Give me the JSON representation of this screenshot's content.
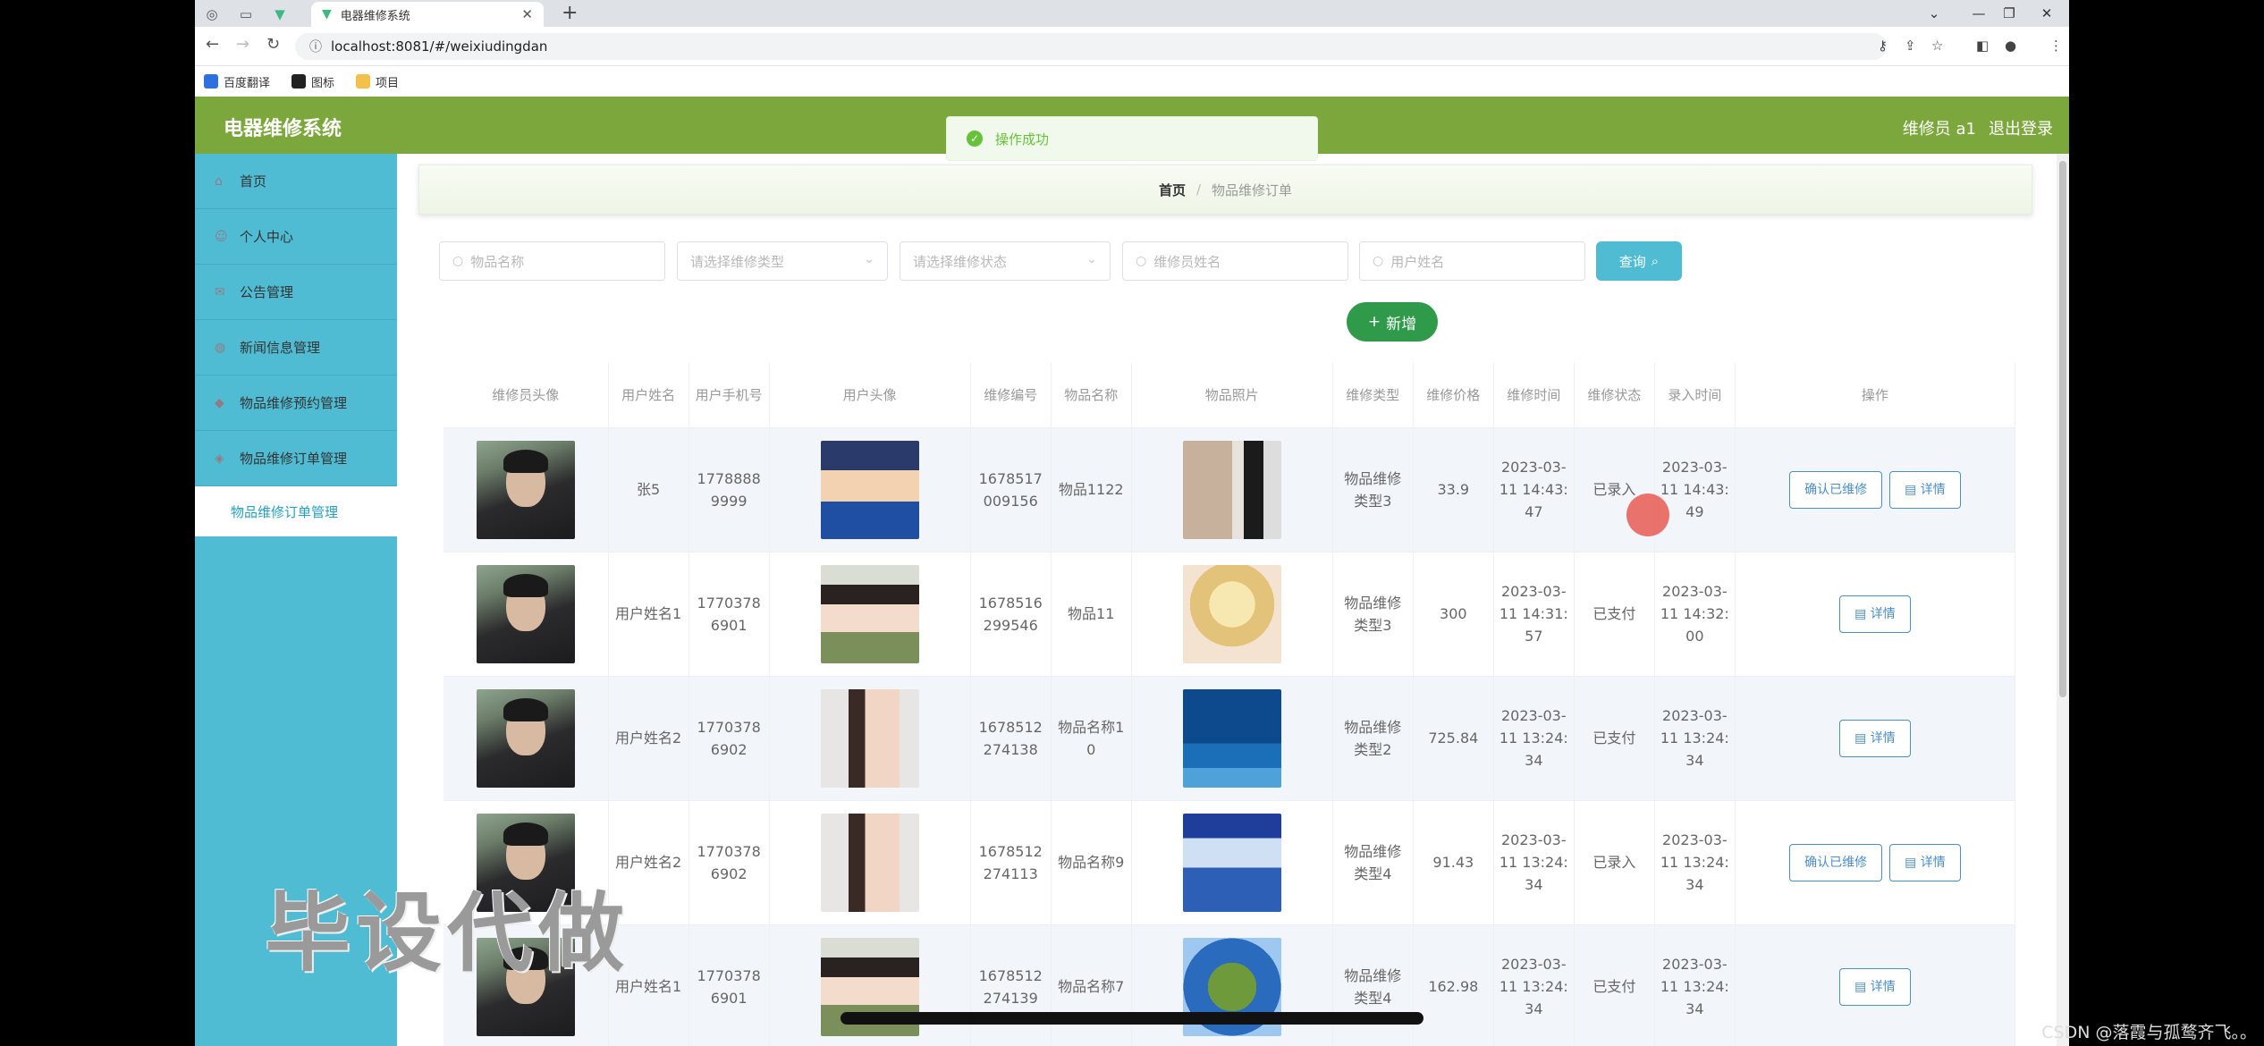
{
  "browser": {
    "tab_title": "电器维修系统",
    "url": "localhost:8081/#/weixiudingdan",
    "bookmarks": [
      "百度翻译",
      "图标",
      "项目"
    ]
  },
  "app": {
    "title": "电器维修系统",
    "user": "维修员 a1",
    "logout": "退出登录",
    "toast": "操作成功"
  },
  "sidebar": {
    "items": [
      {
        "label": "首页"
      },
      {
        "label": "个人中心"
      },
      {
        "label": "公告管理"
      },
      {
        "label": "新闻信息管理"
      },
      {
        "label": "物品维修预约管理"
      },
      {
        "label": "物品维修订单管理"
      }
    ],
    "active_sub": "物品维修订单管理"
  },
  "breadcrumb": {
    "home": "首页",
    "separator": "/",
    "current": "物品维修订单"
  },
  "search": {
    "item_name_placeholder": "物品名称",
    "repair_type_placeholder": "请选择维修类型",
    "repair_status_placeholder": "请选择维修状态",
    "worker_name_placeholder": "维修员姓名",
    "user_name_placeholder": "用户姓名",
    "query_label": "查询",
    "add_label": "新增"
  },
  "table": {
    "headers": [
      "维修员头像",
      "用户姓名",
      "用户手机号",
      "用户头像",
      "维修编号",
      "物品名称",
      "物品照片",
      "维修类型",
      "维修价格",
      "维修时间",
      "维修状态",
      "录入时间",
      "操作"
    ],
    "confirm_label": "确认已维修",
    "detail_label": "详情",
    "rows": [
      {
        "user_name": "张5",
        "phone": "17788889999",
        "repair_no": "1678517009156",
        "item_name": "物品1122",
        "repair_type": "物品维修类型3",
        "price": "33.9",
        "repair_time": "2023-03-11 14:43:47",
        "status": "已录入",
        "entry_time": "2023-03-11 14:43:49",
        "confirm": true
      },
      {
        "user_name": "用户姓名1",
        "phone": "17703786901",
        "repair_no": "1678516299546",
        "item_name": "物品11",
        "repair_type": "物品维修类型3",
        "price": "300",
        "repair_time": "2023-03-11 14:31:57",
        "status": "已支付",
        "entry_time": "2023-03-11 14:32:00",
        "confirm": false
      },
      {
        "user_name": "用户姓名2",
        "phone": "17703786902",
        "repair_no": "1678512274138",
        "item_name": "物品名称10",
        "repair_type": "物品维修类型2",
        "price": "725.84",
        "repair_time": "2023-03-11 13:24:34",
        "status": "已支付",
        "entry_time": "2023-03-11 13:24:34",
        "confirm": false
      },
      {
        "user_name": "用户姓名2",
        "phone": "17703786902",
        "repair_no": "1678512274113",
        "item_name": "物品名称9",
        "repair_type": "物品维修类型4",
        "price": "91.43",
        "repair_time": "2023-03-11 13:24:34",
        "status": "已录入",
        "entry_time": "2023-03-11 13:24:34",
        "confirm": true
      },
      {
        "user_name": "用户姓名1",
        "phone": "17703786901",
        "repair_no": "1678512274139",
        "item_name": "物品名称7",
        "repair_type": "物品维修类型4",
        "price": "162.98",
        "repair_time": "2023-03-11 13:24:34",
        "status": "已支付",
        "entry_time": "2023-03-11 13:24:34",
        "confirm": false
      }
    ]
  },
  "overlay": {
    "caption": "毕设代做",
    "watermark": "CSDN @落霞与孤鹜齐飞。。"
  },
  "colors": {
    "header_green": "#7ba73c",
    "sidebar_blue": "#4fbcd3",
    "add_green": "#2e9a4a",
    "success": "#67c23a"
  }
}
